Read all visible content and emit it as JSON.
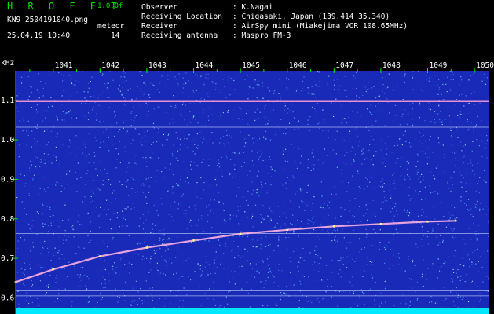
{
  "header": {
    "app_name": "H R O F F T",
    "version": "1.0.0f",
    "filename": "KN9_2504191040.png",
    "datetime": "25.04.19 10:40",
    "event_label": "meteor",
    "count": "14",
    "fields": [
      {
        "key": "Observer",
        "value": ": K.Nagai"
      },
      {
        "key": "Receiving Location",
        "value": ": Chigasaki, Japan (139.414 35.340)"
      },
      {
        "key": "Receiver",
        "value": ": AirSpy mini (Miakejima VOR 108.65MHz)"
      },
      {
        "key": "Receiving antenna",
        "value": ": Maspro FM-3"
      }
    ]
  },
  "chart_data": {
    "type": "heatmap",
    "ylabel": "kHz",
    "x_ticks": [
      "1041",
      "1042",
      "1043",
      "1044",
      "1045",
      "1046",
      "1047",
      "1048",
      "1049",
      "1050"
    ],
    "y_ticks": [
      "1.1",
      "1.0",
      "0.9",
      "0.8",
      "0.7",
      "0.6"
    ],
    "ylim": [
      0.575,
      1.175
    ],
    "horizontal_lines_khz": [
      1.097,
      1.032,
      0.763,
      0.618,
      0.605
    ],
    "trace": [
      {
        "x": 1040.2,
        "y": 0.64
      },
      {
        "x": 1041.0,
        "y": 0.672
      },
      {
        "x": 1042.0,
        "y": 0.705
      },
      {
        "x": 1043.0,
        "y": 0.727
      },
      {
        "x": 1044.0,
        "y": 0.745
      },
      {
        "x": 1045.0,
        "y": 0.762
      },
      {
        "x": 1046.0,
        "y": 0.772
      },
      {
        "x": 1047.0,
        "y": 0.781
      },
      {
        "x": 1048.0,
        "y": 0.787
      },
      {
        "x": 1049.0,
        "y": 0.793
      },
      {
        "x": 1049.6,
        "y": 0.795
      }
    ],
    "colors": {
      "background": "#1a2ab8",
      "noise": "#5aa8ff",
      "line": "#e0e0ff",
      "axis": "#00e600",
      "baseline": "#00e8ff"
    }
  }
}
